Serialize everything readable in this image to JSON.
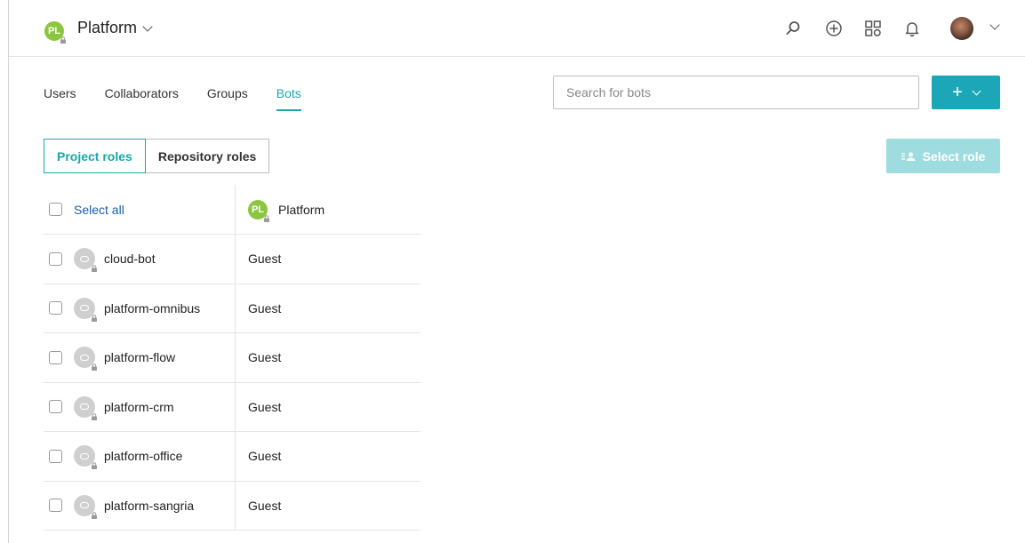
{
  "header": {
    "project_initials": "PL",
    "project_name": "Platform",
    "icons": [
      "search-icon",
      "plus-circle-icon",
      "apps-grid-icon",
      "bell-icon",
      "user-avatar",
      "chevron-down-icon"
    ]
  },
  "tabs": [
    {
      "label": "Users",
      "active": false
    },
    {
      "label": "Collaborators",
      "active": false
    },
    {
      "label": "Groups",
      "active": false
    },
    {
      "label": "Bots",
      "active": true
    }
  ],
  "search": {
    "placeholder": "Search for bots"
  },
  "add_button": {
    "icon": "plus-icon"
  },
  "role_toggle": {
    "project_roles": "Project roles",
    "repository_roles": "Repository roles",
    "active": "project_roles"
  },
  "select_role_button": {
    "label": "Select role",
    "enabled": false
  },
  "table": {
    "select_all_label": "Select all",
    "column_initials": "PL",
    "column_project": "Platform",
    "rows": [
      {
        "name": "cloud-bot",
        "role": "Guest"
      },
      {
        "name": "platform-omnibus",
        "role": "Guest"
      },
      {
        "name": "platform-flow",
        "role": "Guest"
      },
      {
        "name": "platform-crm",
        "role": "Guest"
      },
      {
        "name": "platform-office",
        "role": "Guest"
      },
      {
        "name": "platform-sangria",
        "role": "Guest"
      }
    ]
  },
  "colors": {
    "accent": "#1ba7a6",
    "button": "#1ba7b8",
    "button_disabled": "#9fdcdf",
    "project_avatar": "#8cc63f",
    "link": "#1a5fa8"
  }
}
